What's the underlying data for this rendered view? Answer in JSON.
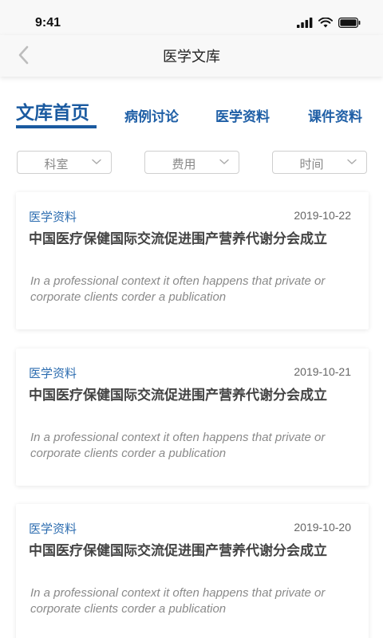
{
  "status_bar": {
    "time": "9:41"
  },
  "header": {
    "title": "医学文库"
  },
  "tabs": [
    {
      "label": "文库首页",
      "active": true
    },
    {
      "label": "病例讨论",
      "active": false
    },
    {
      "label": "医学资料",
      "active": false
    },
    {
      "label": "课件资料",
      "active": false
    }
  ],
  "filters": [
    {
      "label": "科室"
    },
    {
      "label": "费用"
    },
    {
      "label": "时间"
    }
  ],
  "articles": [
    {
      "category": "医学资料",
      "date": "2019-10-22",
      "title": "中国医疗保健国际交流促进围产营养代谢分会成立",
      "description": "In a professional context it often happens that private or corporate clients corder a publication"
    },
    {
      "category": "医学资料",
      "date": "2019-10-21",
      "title": "中国医疗保健国际交流促进围产营养代谢分会成立",
      "description": "In a professional context it often happens that private or corporate clients corder a publication"
    },
    {
      "category": "医学资料",
      "date": "2019-10-20",
      "title": "中国医疗保健国际交流促进围产营养代谢分会成立",
      "description": "In a professional context it often happens that private or corporate clients corder a publication"
    }
  ],
  "colors": {
    "accent": "#1a5aa0",
    "category": "#2d6db0"
  }
}
